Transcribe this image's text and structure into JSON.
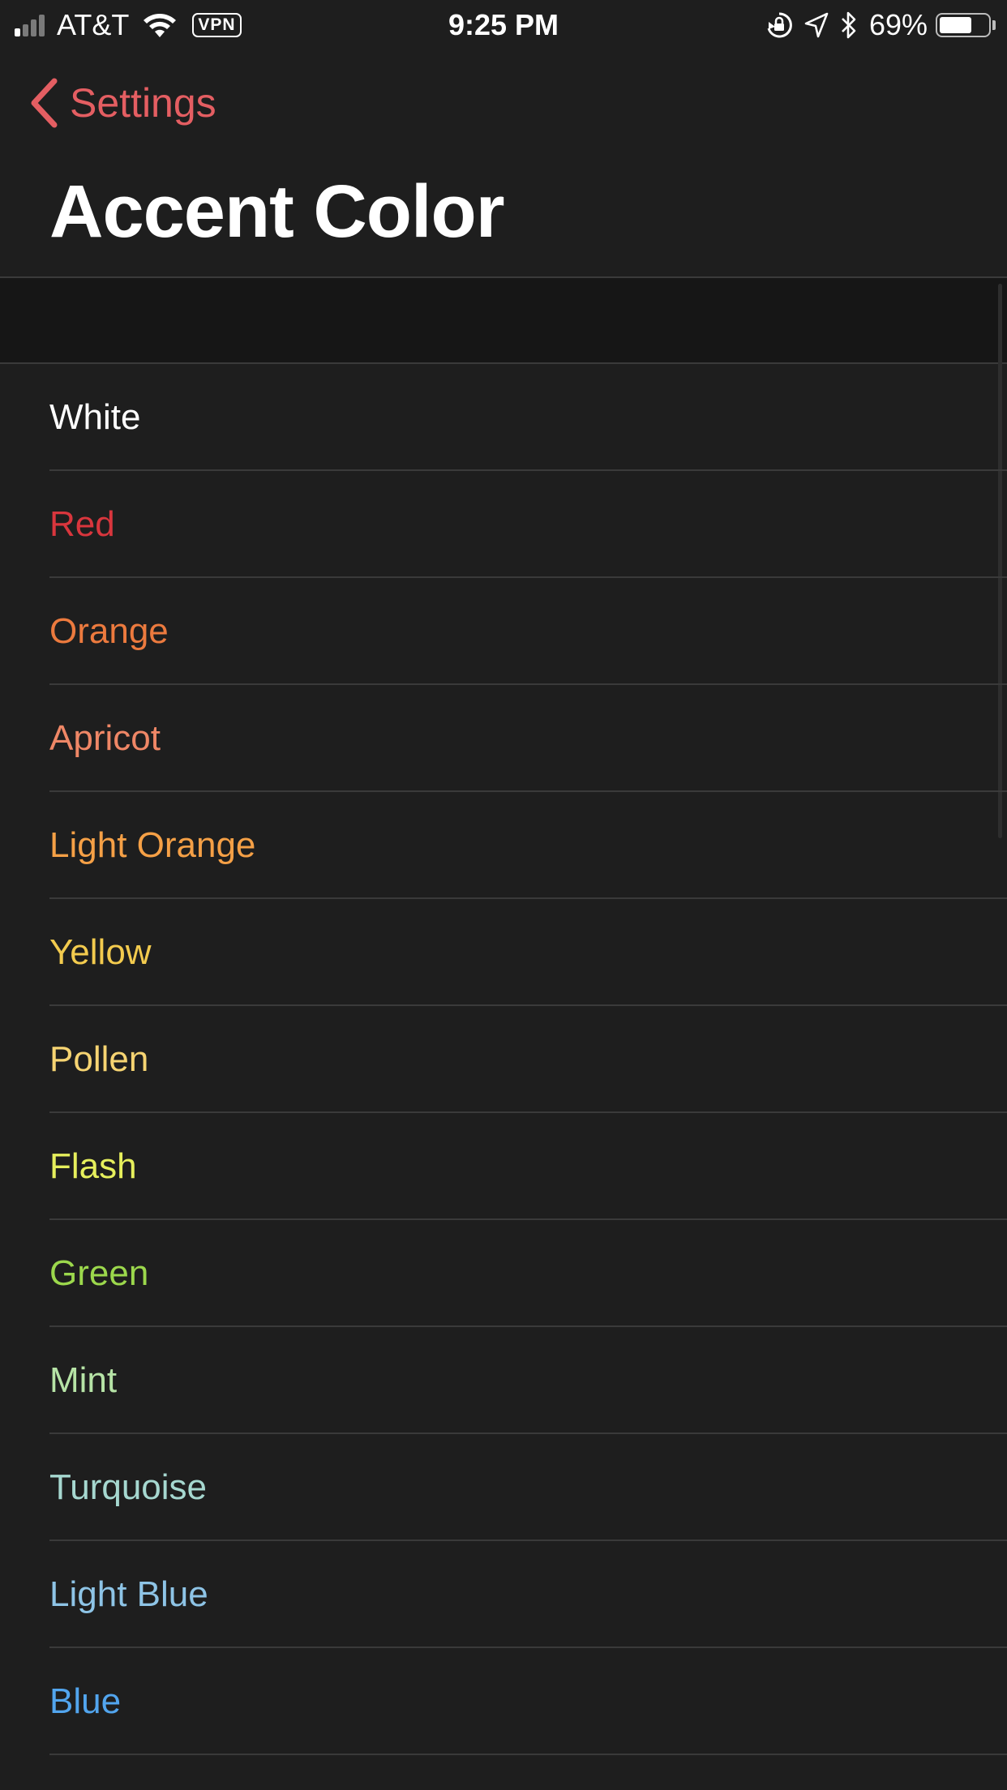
{
  "status_bar": {
    "carrier": "AT&T",
    "vpn_label": "VPN",
    "time": "9:25 PM",
    "battery_percent": "69%",
    "battery_level": 0.69,
    "signal_bars_active": 1,
    "icons": [
      "signal-icon",
      "wifi-icon",
      "vpn-icon",
      "rotation-lock-icon",
      "location-arrow-icon",
      "bluetooth-icon",
      "battery-icon"
    ]
  },
  "nav": {
    "back_label": "Settings",
    "back_icon": "chevron-left-icon",
    "accent": "#e45e62"
  },
  "page": {
    "title": "Accent Color"
  },
  "colors": [
    {
      "label": "White",
      "color": "#ffffff"
    },
    {
      "label": "Red",
      "color": "#d9363d"
    },
    {
      "label": "Orange",
      "color": "#ec7a3e"
    },
    {
      "label": "Apricot",
      "color": "#ef8766"
    },
    {
      "label": "Light Orange",
      "color": "#f5a046"
    },
    {
      "label": "Yellow",
      "color": "#f3cb4e"
    },
    {
      "label": "Pollen",
      "color": "#f6d472"
    },
    {
      "label": "Flash",
      "color": "#e6ef5c"
    },
    {
      "label": "Green",
      "color": "#9cd84c"
    },
    {
      "label": "Mint",
      "color": "#b6e3a6"
    },
    {
      "label": "Turquoise",
      "color": "#a6d8d0"
    },
    {
      "label": "Light Blue",
      "color": "#8ec4e6"
    },
    {
      "label": "Blue",
      "color": "#52a5ee"
    }
  ]
}
